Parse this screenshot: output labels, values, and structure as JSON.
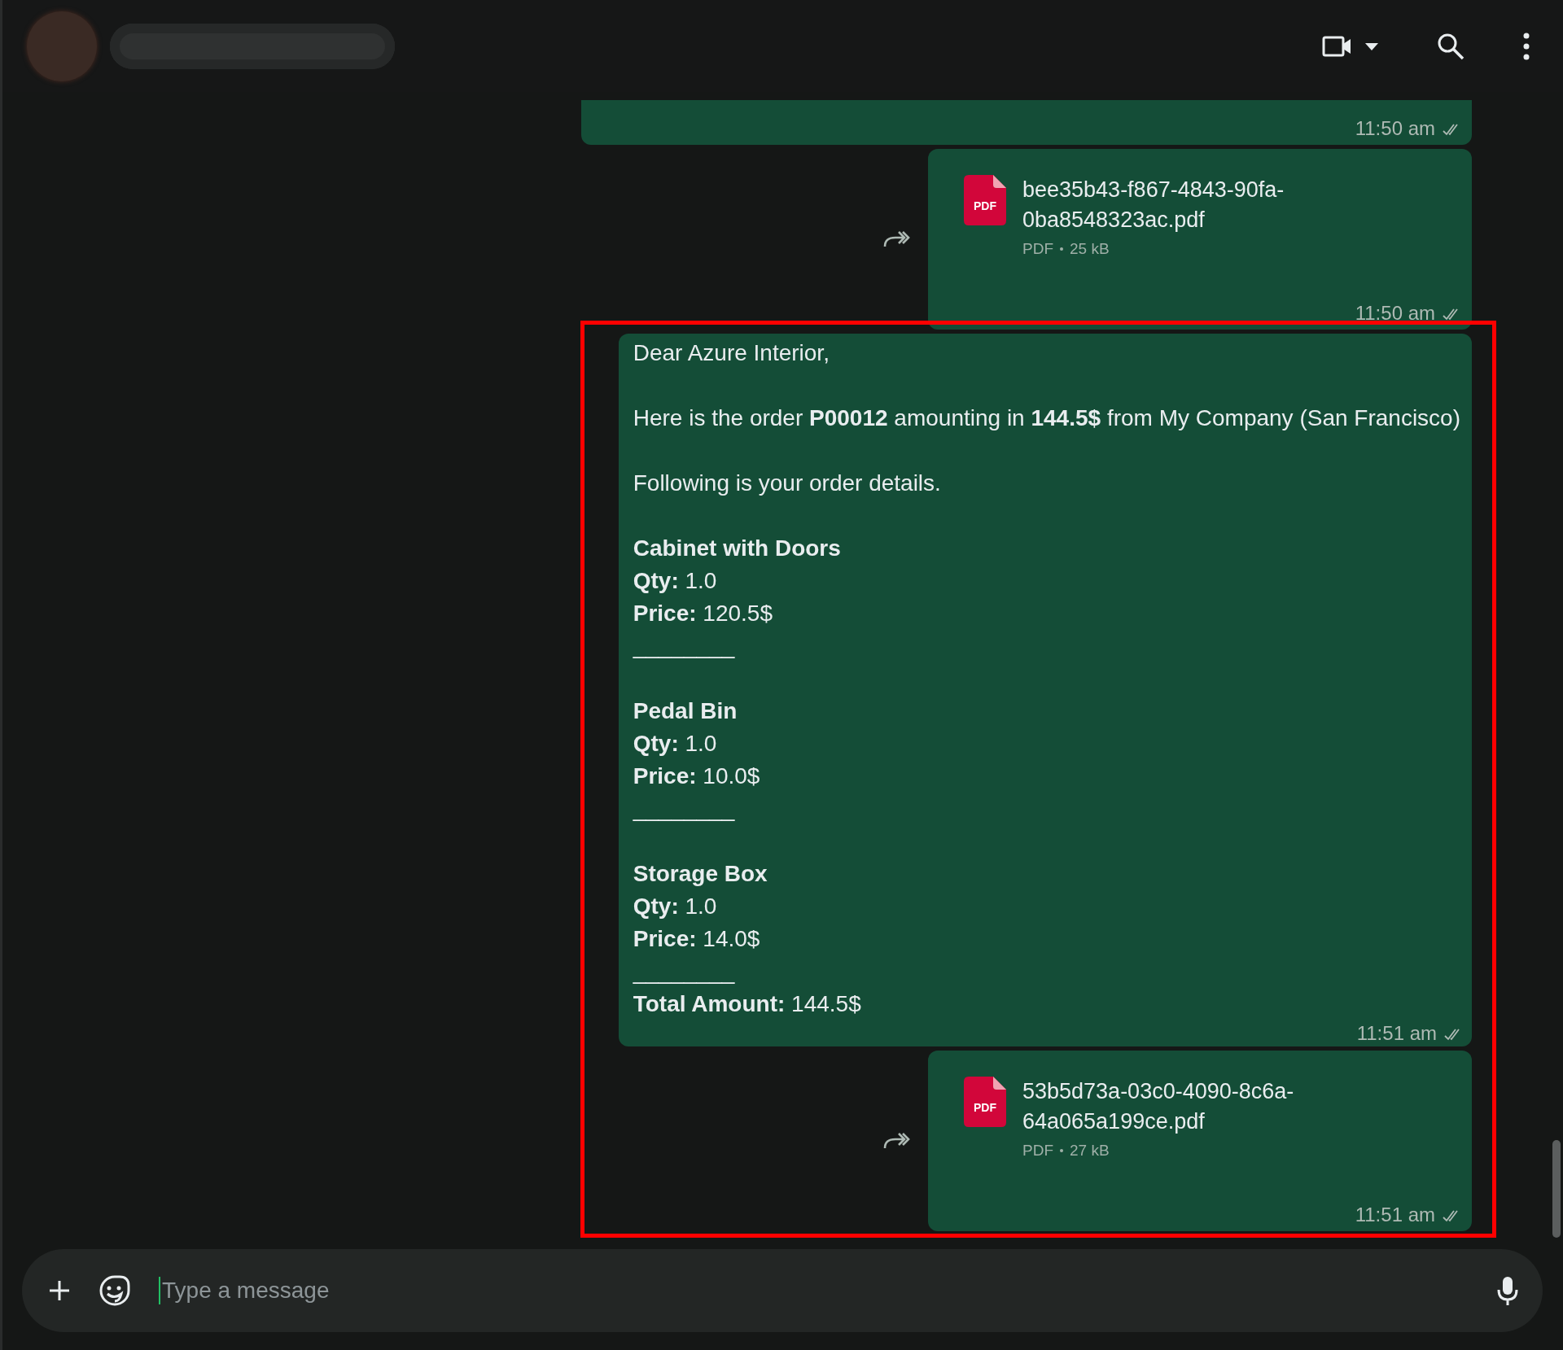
{
  "messages": [
    {
      "kind": "cut",
      "time": "11:50 am",
      "read": true,
      "highlighted": false
    },
    {
      "kind": "file",
      "filename": "bee35b43-f867-4843-90fa-0ba8548323ac.pdf",
      "icon_label": "PDF",
      "filetype": "PDF",
      "size": "25 kB",
      "time": "11:50 am",
      "read": true,
      "highlighted": false
    },
    {
      "kind": "text",
      "time": "11:51 am",
      "read": true,
      "highlighted": true,
      "blocks": [
        [
          {
            "kind": "text",
            "text": "Dear Azure Interior,"
          }
        ],
        [
          {
            "kind": "text",
            "text": "Here is the order **P00012** amounting in **144.5$** from My Company (San Francisco)"
          }
        ],
        [
          {
            "kind": "text",
            "text": "Following is your order details."
          }
        ],
        [
          {
            "kind": "heading",
            "text": "Cabinet with Doors"
          },
          {
            "kind": "text",
            "text": "**Qty:** 1.0"
          },
          {
            "kind": "text",
            "text": "**Price:** 120.5$"
          },
          {
            "kind": "text",
            "text": "________"
          }
        ],
        [
          {
            "kind": "heading",
            "text": "Pedal Bin"
          },
          {
            "kind": "text",
            "text": "**Qty:** 1.0"
          },
          {
            "kind": "text",
            "text": "**Price:** 10.0$"
          },
          {
            "kind": "text",
            "text": "________"
          }
        ],
        [
          {
            "kind": "heading",
            "text": "Storage Box"
          },
          {
            "kind": "text",
            "text": "**Qty:** 1.0"
          },
          {
            "kind": "text",
            "text": "**Price:** 14.0$"
          },
          {
            "kind": "text",
            "text": "________"
          },
          {
            "kind": "text",
            "text": "**Total Amount:** 144.5$"
          }
        ]
      ]
    },
    {
      "kind": "file",
      "filename": "53b5d73a-03c0-4090-8c6a-64a065a199ce.pdf",
      "icon_label": "PDF",
      "filetype": "PDF",
      "size": "27 kB",
      "time": "11:51 am",
      "read": true,
      "highlighted": true
    }
  ],
  "composer": {
    "placeholder": "Type a message"
  }
}
